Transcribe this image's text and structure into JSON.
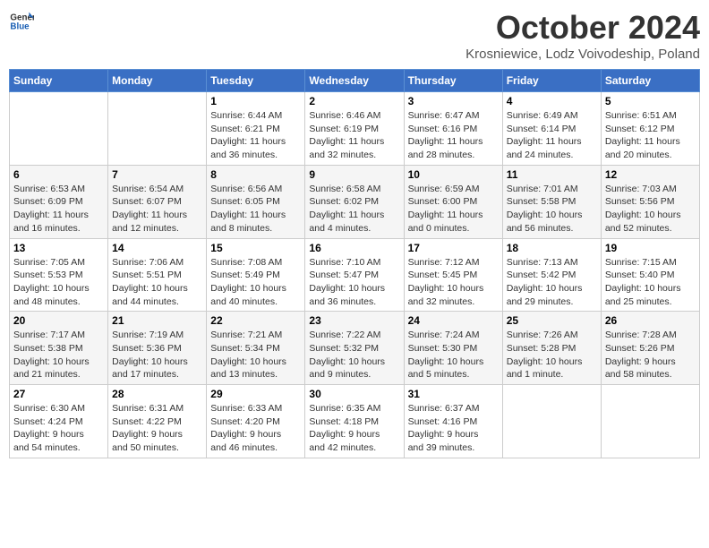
{
  "header": {
    "logo_line1": "General",
    "logo_line2": "Blue",
    "month": "October 2024",
    "location": "Krosniewice, Lodz Voivodeship, Poland"
  },
  "weekdays": [
    "Sunday",
    "Monday",
    "Tuesday",
    "Wednesday",
    "Thursday",
    "Friday",
    "Saturday"
  ],
  "weeks": [
    [
      {
        "day": "",
        "info": ""
      },
      {
        "day": "",
        "info": ""
      },
      {
        "day": "1",
        "info": "Sunrise: 6:44 AM\nSunset: 6:21 PM\nDaylight: 11 hours\nand 36 minutes."
      },
      {
        "day": "2",
        "info": "Sunrise: 6:46 AM\nSunset: 6:19 PM\nDaylight: 11 hours\nand 32 minutes."
      },
      {
        "day": "3",
        "info": "Sunrise: 6:47 AM\nSunset: 6:16 PM\nDaylight: 11 hours\nand 28 minutes."
      },
      {
        "day": "4",
        "info": "Sunrise: 6:49 AM\nSunset: 6:14 PM\nDaylight: 11 hours\nand 24 minutes."
      },
      {
        "day": "5",
        "info": "Sunrise: 6:51 AM\nSunset: 6:12 PM\nDaylight: 11 hours\nand 20 minutes."
      }
    ],
    [
      {
        "day": "6",
        "info": "Sunrise: 6:53 AM\nSunset: 6:09 PM\nDaylight: 11 hours\nand 16 minutes."
      },
      {
        "day": "7",
        "info": "Sunrise: 6:54 AM\nSunset: 6:07 PM\nDaylight: 11 hours\nand 12 minutes."
      },
      {
        "day": "8",
        "info": "Sunrise: 6:56 AM\nSunset: 6:05 PM\nDaylight: 11 hours\nand 8 minutes."
      },
      {
        "day": "9",
        "info": "Sunrise: 6:58 AM\nSunset: 6:02 PM\nDaylight: 11 hours\nand 4 minutes."
      },
      {
        "day": "10",
        "info": "Sunrise: 6:59 AM\nSunset: 6:00 PM\nDaylight: 11 hours\nand 0 minutes."
      },
      {
        "day": "11",
        "info": "Sunrise: 7:01 AM\nSunset: 5:58 PM\nDaylight: 10 hours\nand 56 minutes."
      },
      {
        "day": "12",
        "info": "Sunrise: 7:03 AM\nSunset: 5:56 PM\nDaylight: 10 hours\nand 52 minutes."
      }
    ],
    [
      {
        "day": "13",
        "info": "Sunrise: 7:05 AM\nSunset: 5:53 PM\nDaylight: 10 hours\nand 48 minutes."
      },
      {
        "day": "14",
        "info": "Sunrise: 7:06 AM\nSunset: 5:51 PM\nDaylight: 10 hours\nand 44 minutes."
      },
      {
        "day": "15",
        "info": "Sunrise: 7:08 AM\nSunset: 5:49 PM\nDaylight: 10 hours\nand 40 minutes."
      },
      {
        "day": "16",
        "info": "Sunrise: 7:10 AM\nSunset: 5:47 PM\nDaylight: 10 hours\nand 36 minutes."
      },
      {
        "day": "17",
        "info": "Sunrise: 7:12 AM\nSunset: 5:45 PM\nDaylight: 10 hours\nand 32 minutes."
      },
      {
        "day": "18",
        "info": "Sunrise: 7:13 AM\nSunset: 5:42 PM\nDaylight: 10 hours\nand 29 minutes."
      },
      {
        "day": "19",
        "info": "Sunrise: 7:15 AM\nSunset: 5:40 PM\nDaylight: 10 hours\nand 25 minutes."
      }
    ],
    [
      {
        "day": "20",
        "info": "Sunrise: 7:17 AM\nSunset: 5:38 PM\nDaylight: 10 hours\nand 21 minutes."
      },
      {
        "day": "21",
        "info": "Sunrise: 7:19 AM\nSunset: 5:36 PM\nDaylight: 10 hours\nand 17 minutes."
      },
      {
        "day": "22",
        "info": "Sunrise: 7:21 AM\nSunset: 5:34 PM\nDaylight: 10 hours\nand 13 minutes."
      },
      {
        "day": "23",
        "info": "Sunrise: 7:22 AM\nSunset: 5:32 PM\nDaylight: 10 hours\nand 9 minutes."
      },
      {
        "day": "24",
        "info": "Sunrise: 7:24 AM\nSunset: 5:30 PM\nDaylight: 10 hours\nand 5 minutes."
      },
      {
        "day": "25",
        "info": "Sunrise: 7:26 AM\nSunset: 5:28 PM\nDaylight: 10 hours\nand 1 minute."
      },
      {
        "day": "26",
        "info": "Sunrise: 7:28 AM\nSunset: 5:26 PM\nDaylight: 9 hours\nand 58 minutes."
      }
    ],
    [
      {
        "day": "27",
        "info": "Sunrise: 6:30 AM\nSunset: 4:24 PM\nDaylight: 9 hours\nand 54 minutes."
      },
      {
        "day": "28",
        "info": "Sunrise: 6:31 AM\nSunset: 4:22 PM\nDaylight: 9 hours\nand 50 minutes."
      },
      {
        "day": "29",
        "info": "Sunrise: 6:33 AM\nSunset: 4:20 PM\nDaylight: 9 hours\nand 46 minutes."
      },
      {
        "day": "30",
        "info": "Sunrise: 6:35 AM\nSunset: 4:18 PM\nDaylight: 9 hours\nand 42 minutes."
      },
      {
        "day": "31",
        "info": "Sunrise: 6:37 AM\nSunset: 4:16 PM\nDaylight: 9 hours\nand 39 minutes."
      },
      {
        "day": "",
        "info": ""
      },
      {
        "day": "",
        "info": ""
      }
    ]
  ]
}
